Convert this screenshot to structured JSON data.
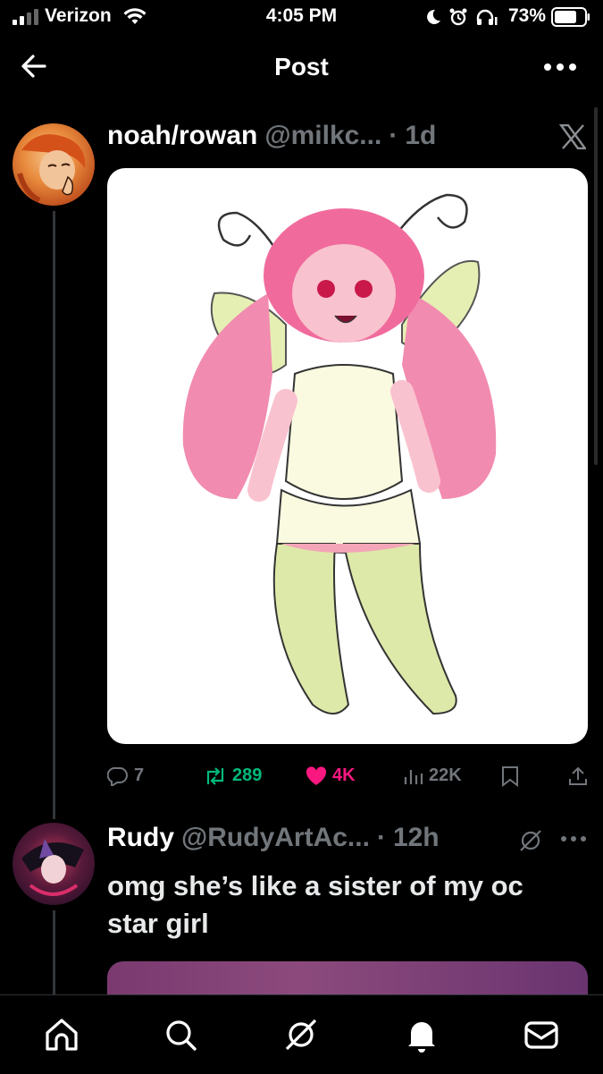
{
  "status_bar": {
    "carrier": "Verizon",
    "time": "4:05 PM",
    "battery": "73%"
  },
  "header": {
    "title": "Post"
  },
  "tweet": {
    "author_name": "noah/rowan",
    "handle": "@milkc...",
    "sep": "·",
    "age": "1d",
    "stats": {
      "replies": "7",
      "reposts": "289",
      "likes": "4K",
      "views": "22K"
    }
  },
  "reply": {
    "author_name": "Rudy",
    "handle": "@RudyArtAc...",
    "sep": "·",
    "age": "12h",
    "text": "omg she’s like a sister of my oc star girl"
  },
  "colors": {
    "background": "#000000",
    "repost_green": "#00ba7c",
    "like_pink": "#f91880",
    "muted": "#71767b"
  },
  "icons": [
    "back-arrow-icon",
    "more-icon",
    "x-logo-icon",
    "reply-icon",
    "repost-icon",
    "like-icon",
    "views-icon",
    "bookmark-icon",
    "share-icon",
    "grok-icon",
    "home-icon",
    "search-icon",
    "notifications-icon",
    "messages-icon"
  ]
}
